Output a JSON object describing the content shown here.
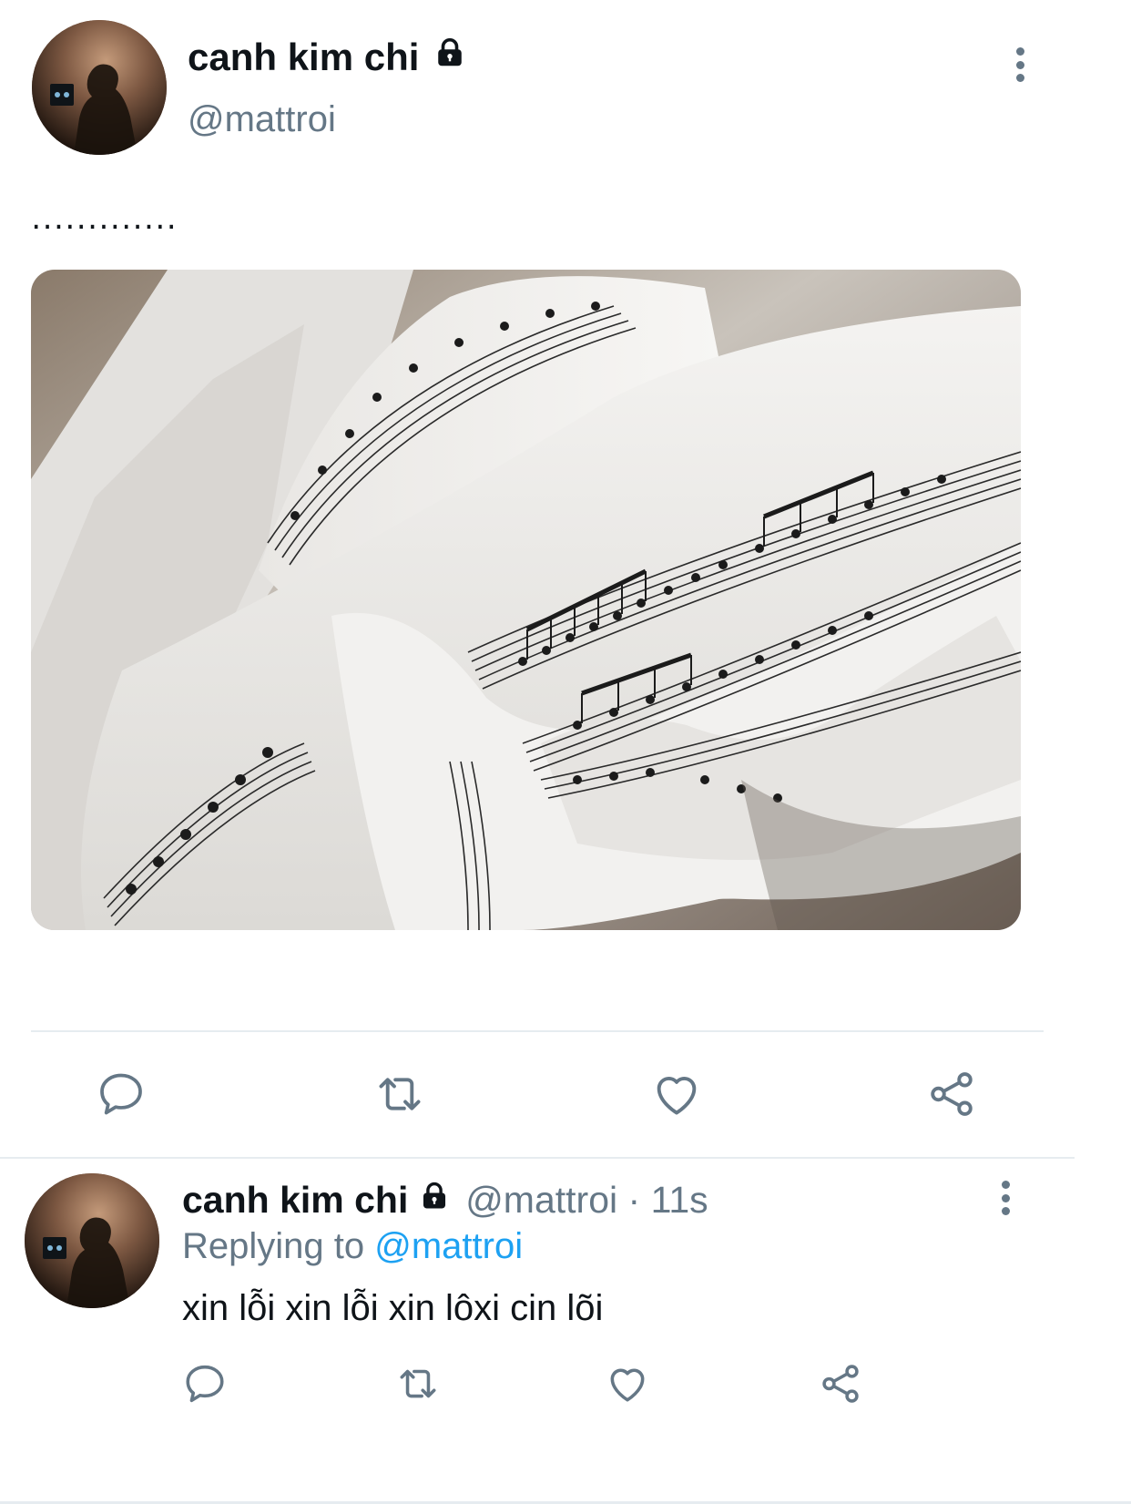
{
  "tweet": {
    "display_name": "canh kim chi",
    "handle": "@mattroi",
    "text": "․․․․․․․․․․․․․",
    "icons": {
      "lock": "lock-icon",
      "more": "more-vertical-icon",
      "reply": "reply-icon",
      "retweet": "retweet-icon",
      "like": "like-icon",
      "share": "share-icon"
    }
  },
  "reply": {
    "display_name": "canh kim chi",
    "handle": "@mattroi",
    "separator": "·",
    "time": "11s",
    "replying_prefix": "Replying to",
    "replying_to": "@mattroi",
    "text": "xin lỗi xin lỗi xin lôxi cin lõi"
  },
  "colors": {
    "text": "#0f1419",
    "secondary": "#657786",
    "accent": "#1da1f2",
    "divider": "#e6ecf0"
  }
}
